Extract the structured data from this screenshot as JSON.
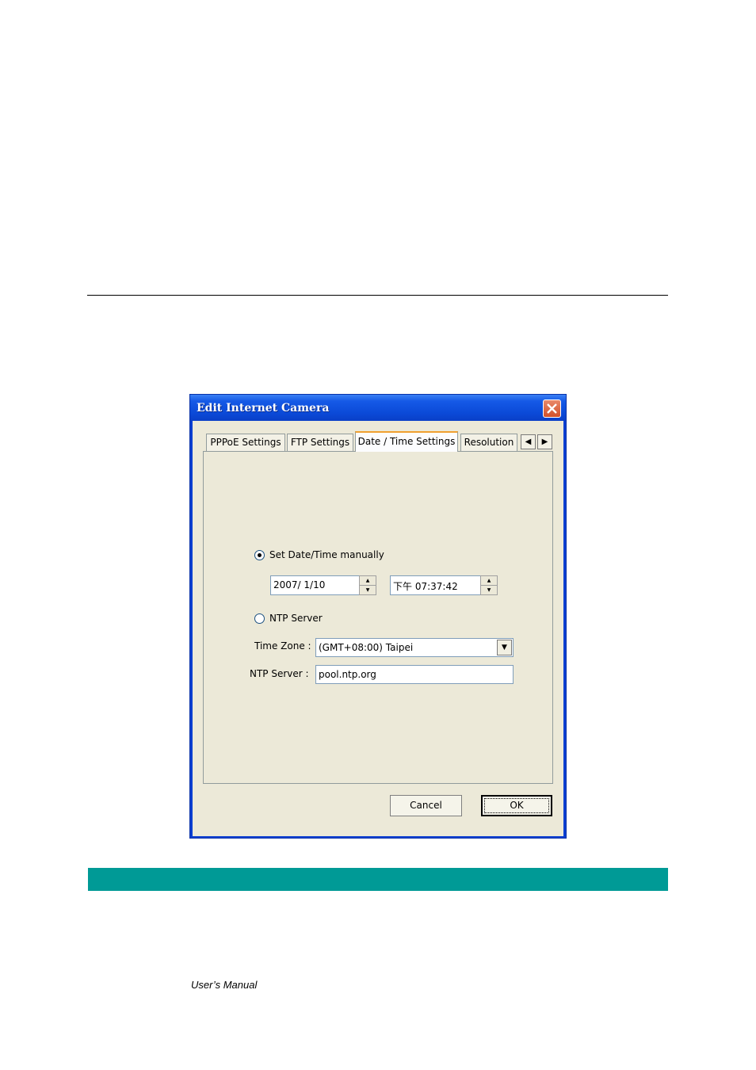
{
  "dialog": {
    "title": "Edit Internet Camera",
    "close_glyph": "✕",
    "tabs": [
      {
        "label": "PPPoE Settings"
      },
      {
        "label": "FTP Settings"
      },
      {
        "label": "Date / Time Settings"
      },
      {
        "label": "Resolution"
      }
    ],
    "tab_scroll_left": "◀",
    "tab_scroll_right": "▶",
    "manual_radio_label": "Set Date/Time manually",
    "date_value": "2007/  1/10",
    "time_value": "下午 07:37:42",
    "ntp_radio_label": "NTP Server",
    "time_zone_label": "Time Zone :",
    "time_zone_value": "(GMT+08:00) Taipei",
    "ntp_server_label": "NTP Server :",
    "ntp_server_value": "pool.ntp.org",
    "cancel_label": "Cancel",
    "ok_label": "OK",
    "spin_up": "▲",
    "spin_down": "▼",
    "combo_arrow": "▼"
  },
  "footer": {
    "text": "User’s Manual"
  },
  "colors": {
    "band": "#009a96",
    "title_bar": "#0b4ad8",
    "dialog_face": "#ece9d8"
  }
}
